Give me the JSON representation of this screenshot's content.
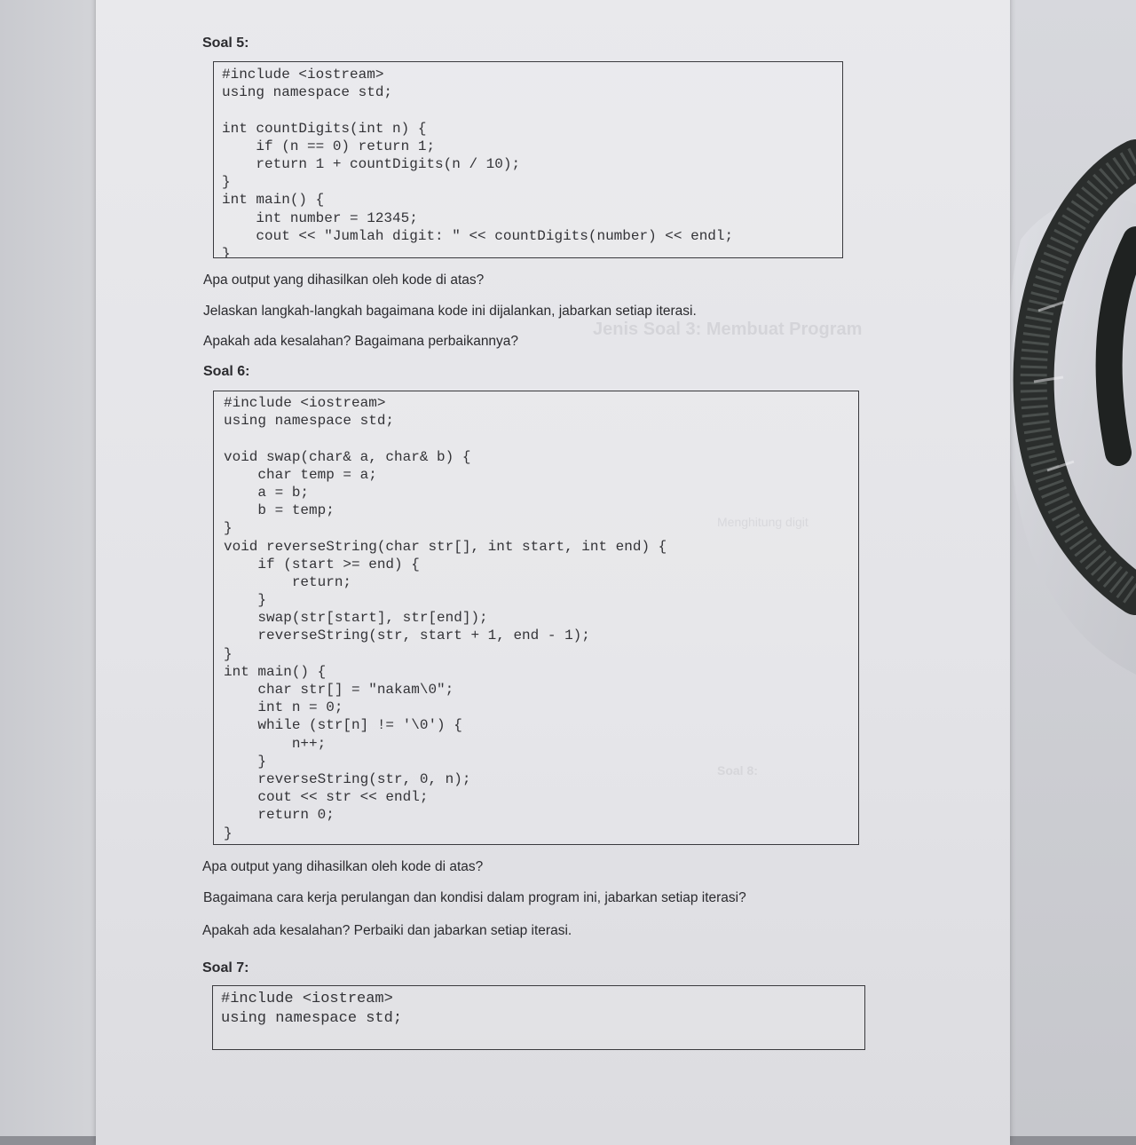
{
  "soal5": {
    "heading": "Soal 5:",
    "code": [
      "#include <iostream>",
      "using namespace std;",
      "",
      "int countDigits(int n) {",
      "    if (n == 0) return 1;",
      "    return 1 + countDigits(n / 10);",
      "}",
      "int main() {",
      "    int number = 12345;",
      "    cout << \"Jumlah digit: \" << countDigits(number) << endl;",
      "}"
    ],
    "questions": [
      "Apa output yang dihasilkan oleh kode di atas?",
      "Jelaskan langkah-langkah bagaimana kode ini dijalankan, jabarkan setiap iterasi.",
      "Apakah ada kesalahan? Bagaimana perbaikannya?"
    ]
  },
  "soal6": {
    "heading": "Soal 6:",
    "code": [
      "#include <iostream>",
      "using namespace std;",
      "",
      "void swap(char& a, char& b) {",
      "    char temp = a;",
      "    a = b;",
      "    b = temp;",
      "}",
      "void reverseString(char str[], int start, int end) {",
      "    if (start >= end) {",
      "        return;",
      "    }",
      "    swap(str[start], str[end]);",
      "    reverseString(str, start + 1, end - 1);",
      "}",
      "int main() {",
      "    char str[] = \"nakam\\0\";",
      "    int n = 0;",
      "    while (str[n] != '\\0') {",
      "        n++;",
      "    }",
      "    reverseString(str, 0, n);",
      "    cout << str << endl;",
      "    return 0;",
      "}"
    ],
    "questions": [
      "Apa output yang dihasilkan oleh kode di atas?",
      "Bagaimana cara kerja perulangan dan kondisi dalam program ini, jabarkan setiap iterasi?",
      "Apakah ada kesalahan? Perbaiki dan jabarkan setiap iterasi."
    ]
  },
  "soal7": {
    "heading": "Soal 7:",
    "code": [
      "#include <iostream>",
      "using namespace std;"
    ]
  },
  "bleed_through": [
    "Jenis Soal 3: Membuat Program",
    "Soal 8:",
    "Menghitung digit"
  ]
}
